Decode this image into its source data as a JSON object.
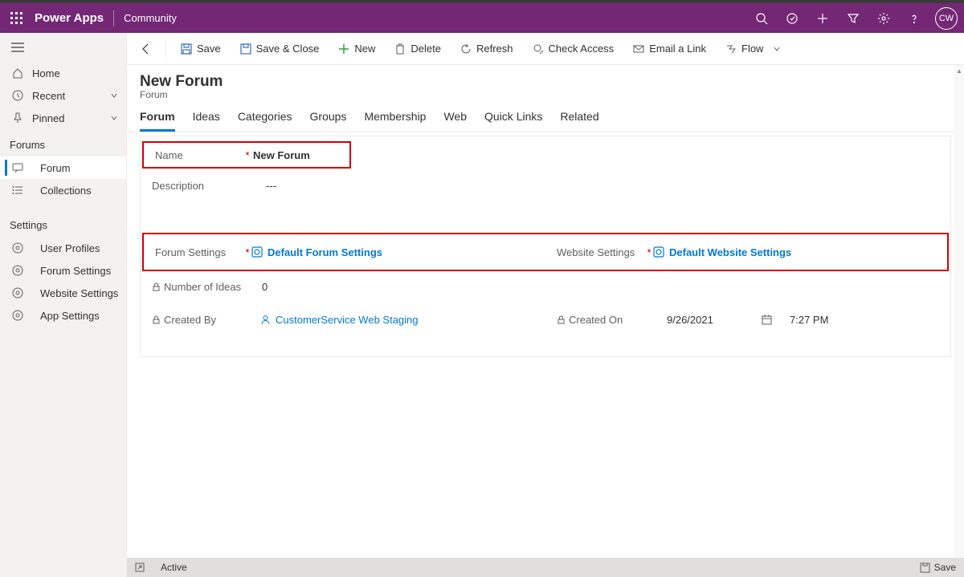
{
  "header": {
    "brand": "Power Apps",
    "sub": "Community",
    "avatar": "CW"
  },
  "nav": {
    "home": "Home",
    "recent": "Recent",
    "pinned": "Pinned",
    "section_forums": "Forums",
    "forum": "Forum",
    "collections": "Collections",
    "section_settings": "Settings",
    "user_profiles": "User Profiles",
    "forum_settings": "Forum Settings",
    "website_settings": "Website Settings",
    "app_settings": "App Settings"
  },
  "cmd": {
    "save": "Save",
    "save_close": "Save & Close",
    "new": "New",
    "delete": "Delete",
    "refresh": "Refresh",
    "check_access": "Check Access",
    "email_link": "Email a Link",
    "flow": "Flow"
  },
  "page": {
    "title": "New Forum",
    "sub": "Forum"
  },
  "tabs": {
    "forum": "Forum",
    "ideas": "Ideas",
    "categories": "Categories",
    "groups": "Groups",
    "membership": "Membership",
    "web": "Web",
    "quick_links": "Quick Links",
    "related": "Related"
  },
  "form": {
    "name_label": "Name",
    "name_value": "New Forum",
    "description_label": "Description",
    "description_value": "---",
    "forum_settings_label": "Forum Settings",
    "forum_settings_value": "Default Forum Settings",
    "website_settings_label": "Website Settings",
    "website_settings_value": "Default Website Settings",
    "num_ideas_label": "Number of Ideas",
    "num_ideas_value": "0",
    "created_by_label": "Created By",
    "created_by_value": "CustomerService Web Staging",
    "created_on_label": "Created On",
    "created_on_date": "9/26/2021",
    "created_on_time": "7:27 PM"
  },
  "status": {
    "state": "Active",
    "save": "Save"
  }
}
